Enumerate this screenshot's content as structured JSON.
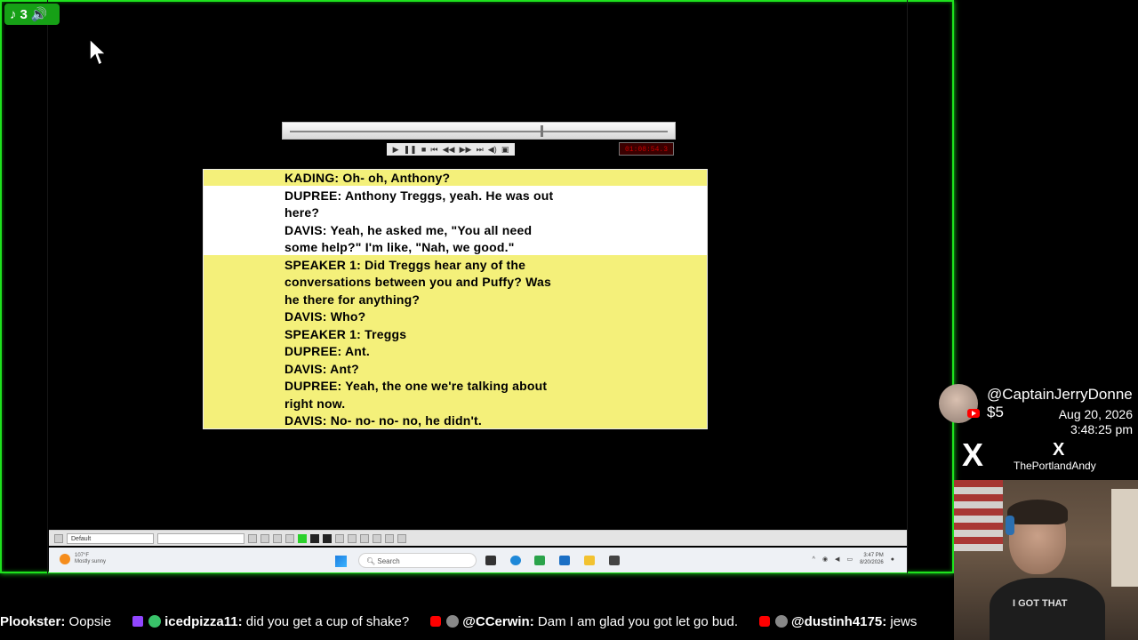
{
  "overlay": {
    "viewer_count": "3",
    "tiktok_icon": "tiktok-icon",
    "speaker_icon": "speaker-icon"
  },
  "player": {
    "time_display": "01:08:54.3",
    "controls": [
      "play-icon",
      "pause-icon",
      "stop-icon",
      "prev-icon",
      "rewind-icon",
      "forward-icon",
      "next-icon",
      "volume-icon",
      "snapshot-icon"
    ]
  },
  "transcript": {
    "lines": [
      "KADING: Oh- oh, Anthony?",
      "DUPREE: Anthony Treggs, yeah. He was out",
      "here?",
      "DAVIS: Yeah, he asked me, \"You all need",
      "some help?\" I'm like, \"Nah, we good.\"",
      "SPEAKER 1: Did Treggs hear any of the",
      "conversations between you and Puffy? Was",
      "he there for anything?",
      "DAVIS: Who?",
      "SPEAKER 1: Treggs",
      "DUPREE: Ant.",
      "DAVIS: Ant?",
      "DUPREE: Yeah, the one we're talking about",
      "right now.",
      "DAVIS: No- no- no- no, he didn't."
    ]
  },
  "app_toolbar": {
    "style_select": "Default"
  },
  "taskbar": {
    "weather_temp": "107°F",
    "weather_desc": "Mostly sunny",
    "search_placeholder": "Search",
    "time": "3:47 PM",
    "date": "8/20/2026"
  },
  "donation": {
    "name": "@CaptainJerryDonne",
    "amount": "$5",
    "date": "Aug 20, 2026",
    "time": "3:48:25 pm",
    "x_logo": "X",
    "x_handle": "ThePortlandAndy"
  },
  "webcam": {
    "shirt_text": "I GOT THAT"
  },
  "chat": [
    {
      "user": "Plookster",
      "text": "Oopsie",
      "platform": "none"
    },
    {
      "user": "icedpizza11",
      "text": "did you get a cup of shake?",
      "platform": "twitch"
    },
    {
      "user": "@CCerwin",
      "text": "Dam I am glad you got let go bud.",
      "platform": "youtube"
    },
    {
      "user": "@dustinh4175",
      "text": "jews",
      "platform": "youtube"
    }
  ],
  "colors": {
    "frame_border": "#1ee31e",
    "transcript_bg": "#f4f07a",
    "transcript_highlight": "#ffffff",
    "youtube_red": "#ff0000",
    "twitch_purple": "#9146ff"
  }
}
